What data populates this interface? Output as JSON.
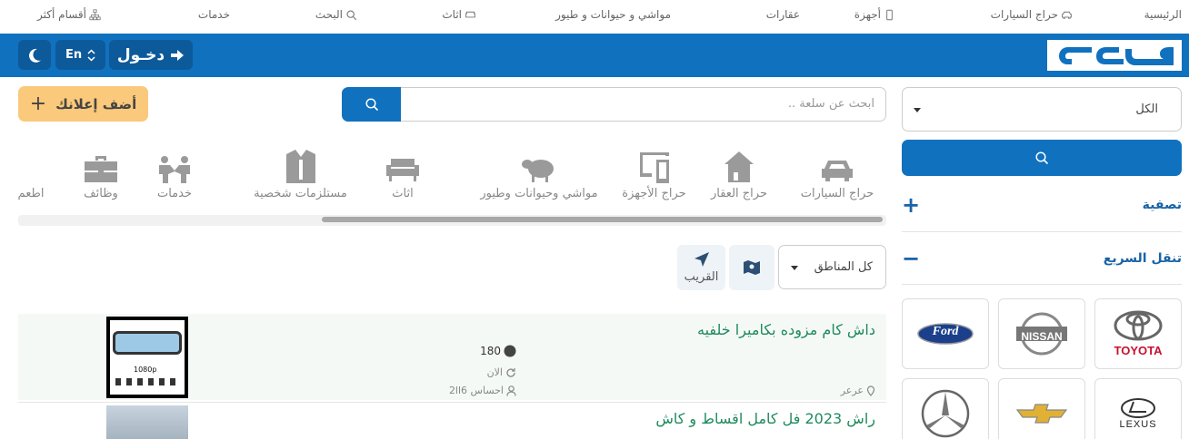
{
  "nav": {
    "items": [
      "الرئيسية",
      "حراج السيارات",
      "أجهزة",
      "عقارات",
      "مواشي و حيوانات و طيور",
      "اثاث",
      "البحث",
      "خدمات",
      "أقسام أكثر"
    ]
  },
  "header": {
    "logo_text": "حراج",
    "login_label": "دخـول",
    "lang_label": "En"
  },
  "search": {
    "placeholder": "ابحث عن سلعة ..",
    "add_ad_label": "أضف إعلانك"
  },
  "sidebar": {
    "region_value": "الكل",
    "filter_label": "تصفية",
    "quick_nav_label": "تنقل السريع",
    "brands": [
      "toyota-logo",
      "nissan-logo",
      "ford-logo",
      "lexus-logo",
      "chevrolet-logo",
      "mercedes-logo"
    ],
    "toyota_text": "TOYOTA",
    "nissan_text": "NISSAN",
    "ford_text": "Ford",
    "lexus_text": "LEXUS"
  },
  "categories": [
    "حراج السيارات",
    "حراج العقار",
    "حراج الأجهزة",
    "مواشي وحيوانات وطيور",
    "اثاث",
    "مستلزمات شخصية",
    "خدمات",
    "وظائف",
    "اطعم"
  ],
  "filters": {
    "area_value": "كل المناطق",
    "nearby_label": "القريب"
  },
  "posts": [
    {
      "title": "داش كام مزوده بكاميرا خلفيه",
      "price": "180",
      "time": "الان",
      "city": "عرعر",
      "user": "احساس 2ll6",
      "thumb_text": "1080p"
    },
    {
      "title": "راش 2023 فل كامل اقساط و كاش"
    }
  ],
  "colors": {
    "primary": "#1071bf",
    "accent": "#fbc97b",
    "post_title": "#1f8a5d"
  }
}
